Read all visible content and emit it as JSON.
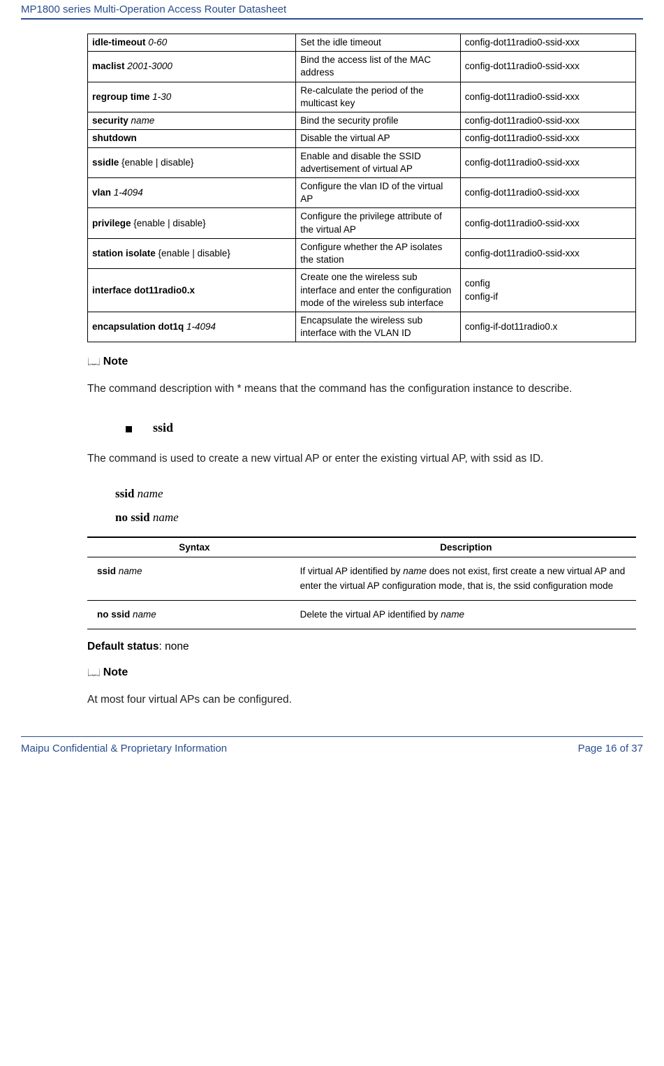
{
  "header": "MP1800 series Multi-Operation Access Router Datasheet",
  "cmdTable": [
    {
      "c1_html": "<span class='b'>idle-timeout</span> <span class='i'>0-60</span>",
      "c2": "Set the idle timeout",
      "c3": "config-dot11radio0-ssid-xxx"
    },
    {
      "c1_html": "<span class='b'>maclist</span> <span class='i'>2001-3000</span>",
      "c2": "Bind the access list of the MAC address",
      "c3": "config-dot11radio0-ssid-xxx"
    },
    {
      "c1_html": "<span class='b'>regroup time</span> <span class='i'>1-30</span>",
      "c2": "Re-calculate the period of the multicast key",
      "c3": "config-dot11radio0-ssid-xxx"
    },
    {
      "c1_html": "<span class='b'>security</span> <span class='i'>name</span>",
      "c2": "Bind the security profile",
      "c3": "config-dot11radio0-ssid-xxx"
    },
    {
      "c1_html": "<span class='b'>shutdown</span>",
      "c2": "Disable the virtual AP",
      "c3": "config-dot11radio0-ssid-xxx"
    },
    {
      "c1_html": "<span class='b'>ssidIe</span> {enable | disable}",
      "c2": "Enable and disable the SSID advertisement of virtual AP",
      "c3": "config-dot11radio0-ssid-xxx"
    },
    {
      "c1_html": "<span class='b'>vlan</span> <span class='i'>1-4094</span>",
      "c2": "Configure the vlan ID of the virtual AP",
      "c3": "config-dot11radio0-ssid-xxx"
    },
    {
      "c1_html": "<span class='b'>privilege</span> {enable | disable}",
      "c2": "Configure the privilege attribute of the virtual AP",
      "c3": "config-dot11radio0-ssid-xxx"
    },
    {
      "c1_html": "<span class='b'>station isolate</span> {enable | disable}",
      "c2": "Configure whether the AP isolates the station",
      "c3": "config-dot11radio0-ssid-xxx"
    },
    {
      "c1_html": "<span class='b'>interface dot11radio0.x</span>",
      "c2": "Create one the wireless sub interface and enter the configuration mode of the wireless sub interface",
      "c3": "config<br>config-if"
    },
    {
      "c1_html": "<span class='b'>encapsulation dot1q</span> <span class='i'>1-4094</span>",
      "c2": "Encapsulate the wireless sub interface with the VLAN ID",
      "c3": "config-if-dot11radio0.x"
    }
  ],
  "note1Label": "Note",
  "note1Body": "The command description with * means that the command has the configuration instance to describe.",
  "sectionTitle": "ssid",
  "sectionDesc": "The command is used to create a new virtual AP or enter the existing virtual AP, with ssid as ID.",
  "syntax1_b": "ssid",
  "syntax1_i": "name",
  "syntax2_b": "no ssid",
  "syntax2_i": "name",
  "synHeader1": "Syntax",
  "synHeader2": "Description",
  "synRows": [
    {
      "s_b": "ssid",
      "s_i": "name",
      "d_html": "If virtual AP identified by <span class='i'>name</span> does not exist, first create a new virtual AP and enter the virtual AP configuration mode, that is, the ssid configuration mode"
    },
    {
      "s_b": "no ssid",
      "s_i": "name",
      "d_html": "Delete the virtual AP identified by <span class='i'>name</span>"
    }
  ],
  "defaultLabel": "Default status",
  "defaultValue": ": none",
  "note2Label": "Note",
  "note2Body": "At most four virtual APs can be configured.",
  "footerLeft": "Maipu Confidential & Proprietary Information",
  "footerRight": "Page 16 of 37"
}
